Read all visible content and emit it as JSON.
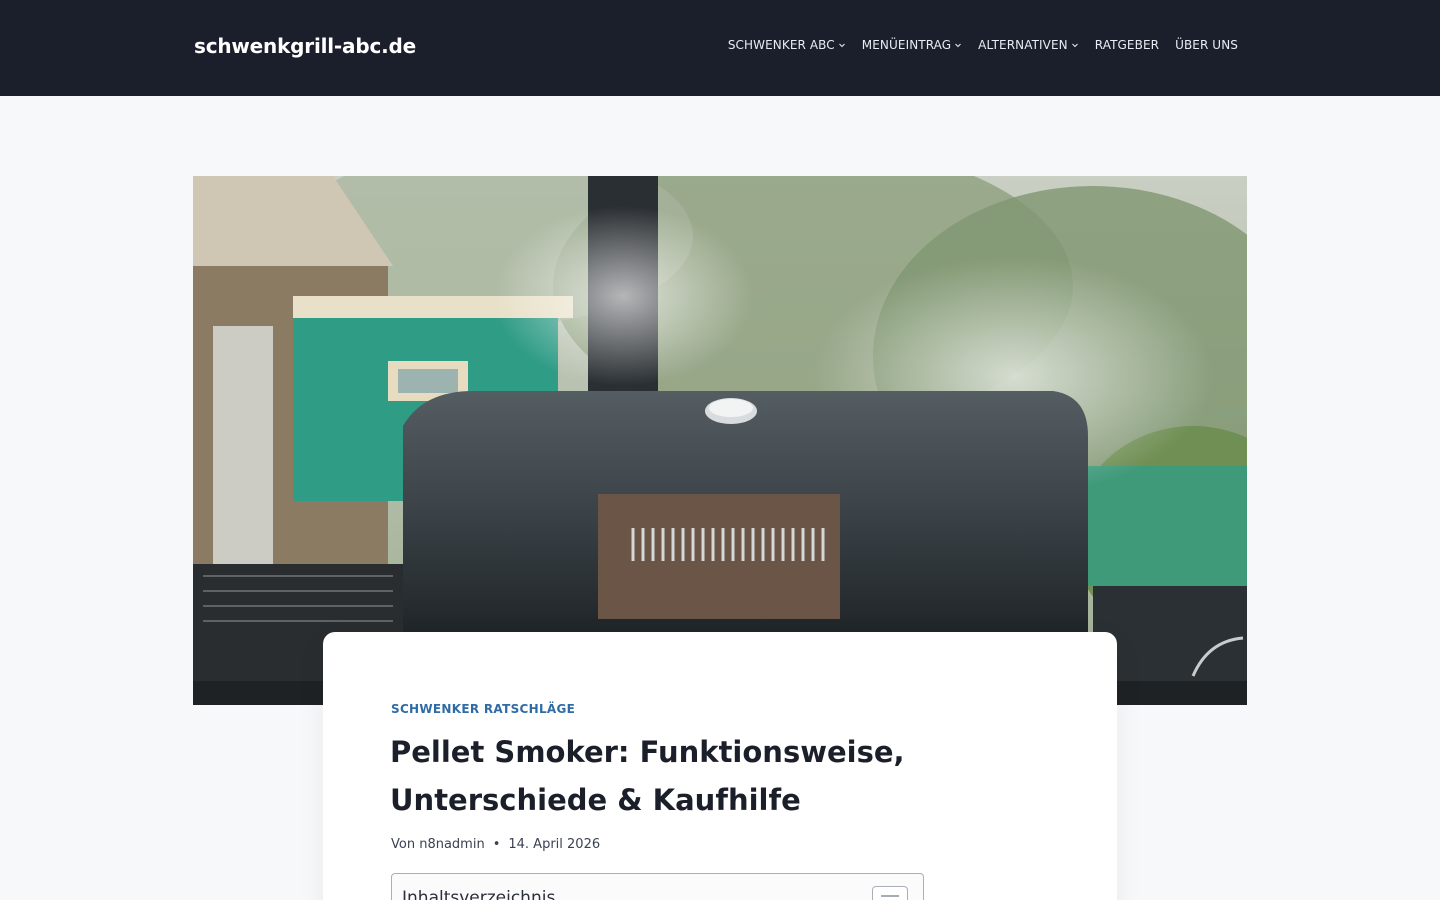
{
  "header": {
    "logo": "schwenkgrill-abc.de",
    "nav": [
      {
        "label": "SCHWENKER ABC",
        "has_dropdown": true
      },
      {
        "label": "MENÜEINTRAG",
        "has_dropdown": true
      },
      {
        "label": "ALTERNATIVEN",
        "has_dropdown": true
      },
      {
        "label": "RATGEBER",
        "has_dropdown": false
      },
      {
        "label": "ÜBER UNS",
        "has_dropdown": false
      }
    ]
  },
  "article": {
    "category": "SCHWENKER RATSCHLÄGE",
    "title": "Pellet Smoker: Funktionsweise, Unterschiede & Kaufhilfe",
    "author_prefix": "Von",
    "author": "n8nadmin",
    "date": "14. April 2026",
    "toc_title": "Inhaltsverzeichnis"
  },
  "icons": {
    "dropdown": "chevron-down-icon",
    "toc_toggle": "list-toggle-icon"
  },
  "colors": {
    "header_bg": "#1b1f2c",
    "page_bg": "#f7f8fa",
    "accent": "#2f6ca6"
  }
}
